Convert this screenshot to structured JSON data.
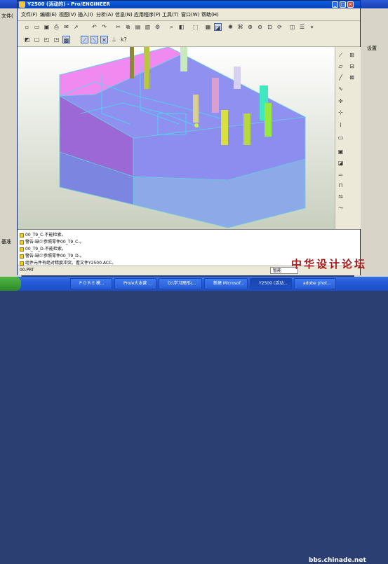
{
  "app": {
    "title": "Y2500 (活动的) - Pro/ENGINEER"
  },
  "background_windows": {
    "left_menu_label": "文件(",
    "left_item": "基准",
    "right_label": "设置"
  },
  "menubar": {
    "items": [
      "文件(F)",
      "编辑(E)",
      "视图(V)",
      "插入(I)",
      "分析(A)",
      "信息(N)",
      "应用程序(P)",
      "工具(T)",
      "窗口(W)",
      "帮助(H)"
    ]
  },
  "messages": [
    {
      "icon": "info",
      "text": "00_T9_C-不能检索。"
    },
    {
      "icon": "warning",
      "text": "警告:缺少参照零件00_T9_C-。"
    },
    {
      "icon": "info",
      "text": "00_T9_D-不能检索。"
    },
    {
      "icon": "warning",
      "text": "警告:缺少参照零件00_T9_D-。"
    },
    {
      "icon": "warning",
      "text": "组件元件有绝对精度冲突。看文件Y2500.ACC。"
    }
  ],
  "status": {
    "command_line": "00.PRT",
    "filter_label": "智能"
  },
  "taskbar": {
    "items": [
      "P O R E 模...",
      "Pro/e大本营 ...",
      "D:\\学习图形\\...",
      "新建 Microsof...",
      "Y2500 (活动...",
      "adobe phot..."
    ]
  },
  "watermark": {
    "text": "中华设计论坛",
    "url": "bbs.chinade.net"
  },
  "colors": {
    "title_blue": "#0a5fe0",
    "model_purple": "#9c68d6",
    "model_pink": "#f08af0",
    "model_blue": "#8f90f0",
    "taskbar_blue": "#245ad6"
  }
}
